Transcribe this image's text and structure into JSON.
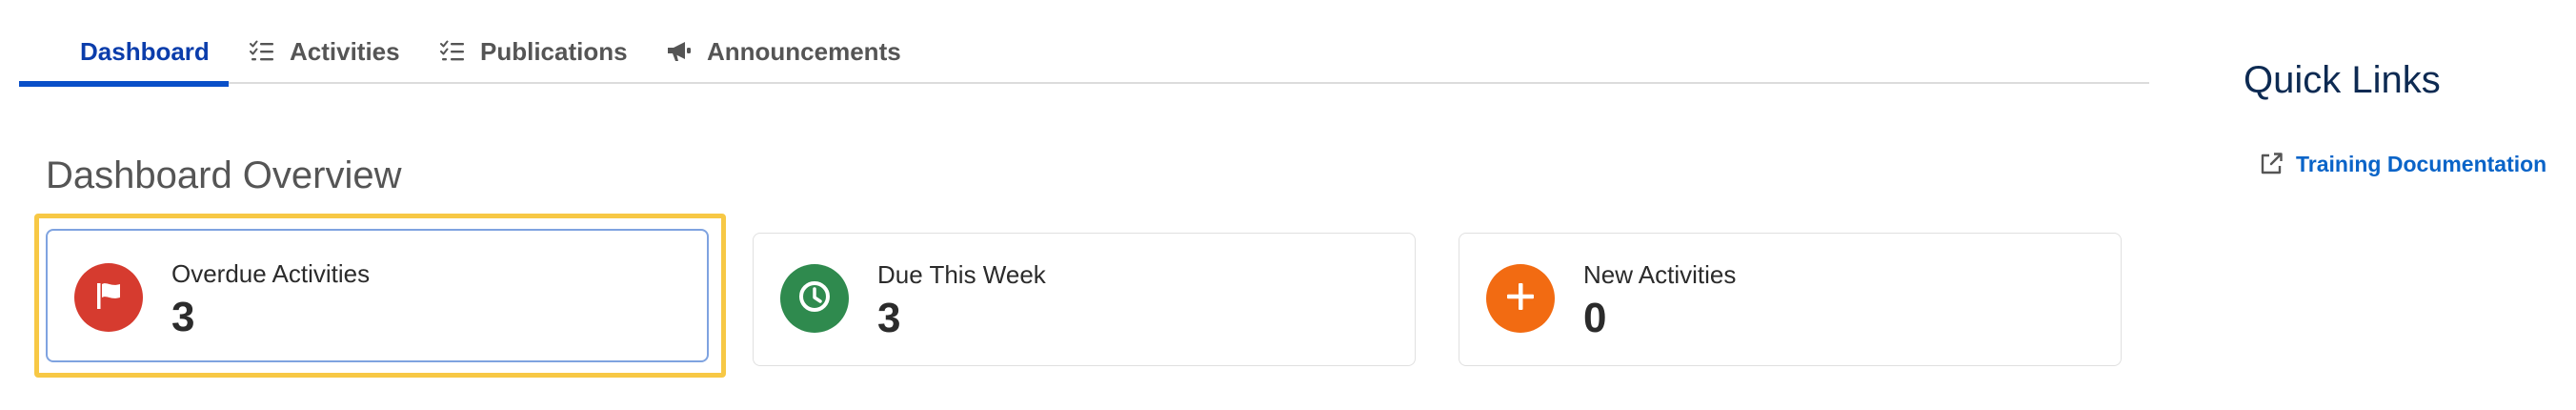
{
  "tabs": [
    {
      "label": "Dashboard",
      "icon": "dashboard",
      "active": true
    },
    {
      "label": "Activities",
      "icon": "checklist-icon",
      "active": false
    },
    {
      "label": "Publications",
      "icon": "checklist-icon",
      "active": false
    },
    {
      "label": "Announcements",
      "icon": "megaphone-icon",
      "active": false
    }
  ],
  "overview": {
    "title": "Dashboard Overview"
  },
  "cards": [
    {
      "label": "Overdue Activities",
      "count": "3",
      "icon": "flag-icon",
      "color": "#d63b2f",
      "selected": true
    },
    {
      "label": "Due This Week",
      "count": "3",
      "icon": "clock-icon",
      "color": "#2f8a4e",
      "selected": false
    },
    {
      "label": "New Activities",
      "count": "0",
      "icon": "plus-icon",
      "color": "#f26b12",
      "selected": false
    }
  ],
  "quick_links": {
    "title": "Quick Links",
    "items": [
      {
        "label": "Training Documentation",
        "icon": "external-link-icon"
      }
    ]
  },
  "colors": {
    "accent": "#0a4fc8",
    "focus": "#f7c845",
    "link": "#0a64c8"
  }
}
